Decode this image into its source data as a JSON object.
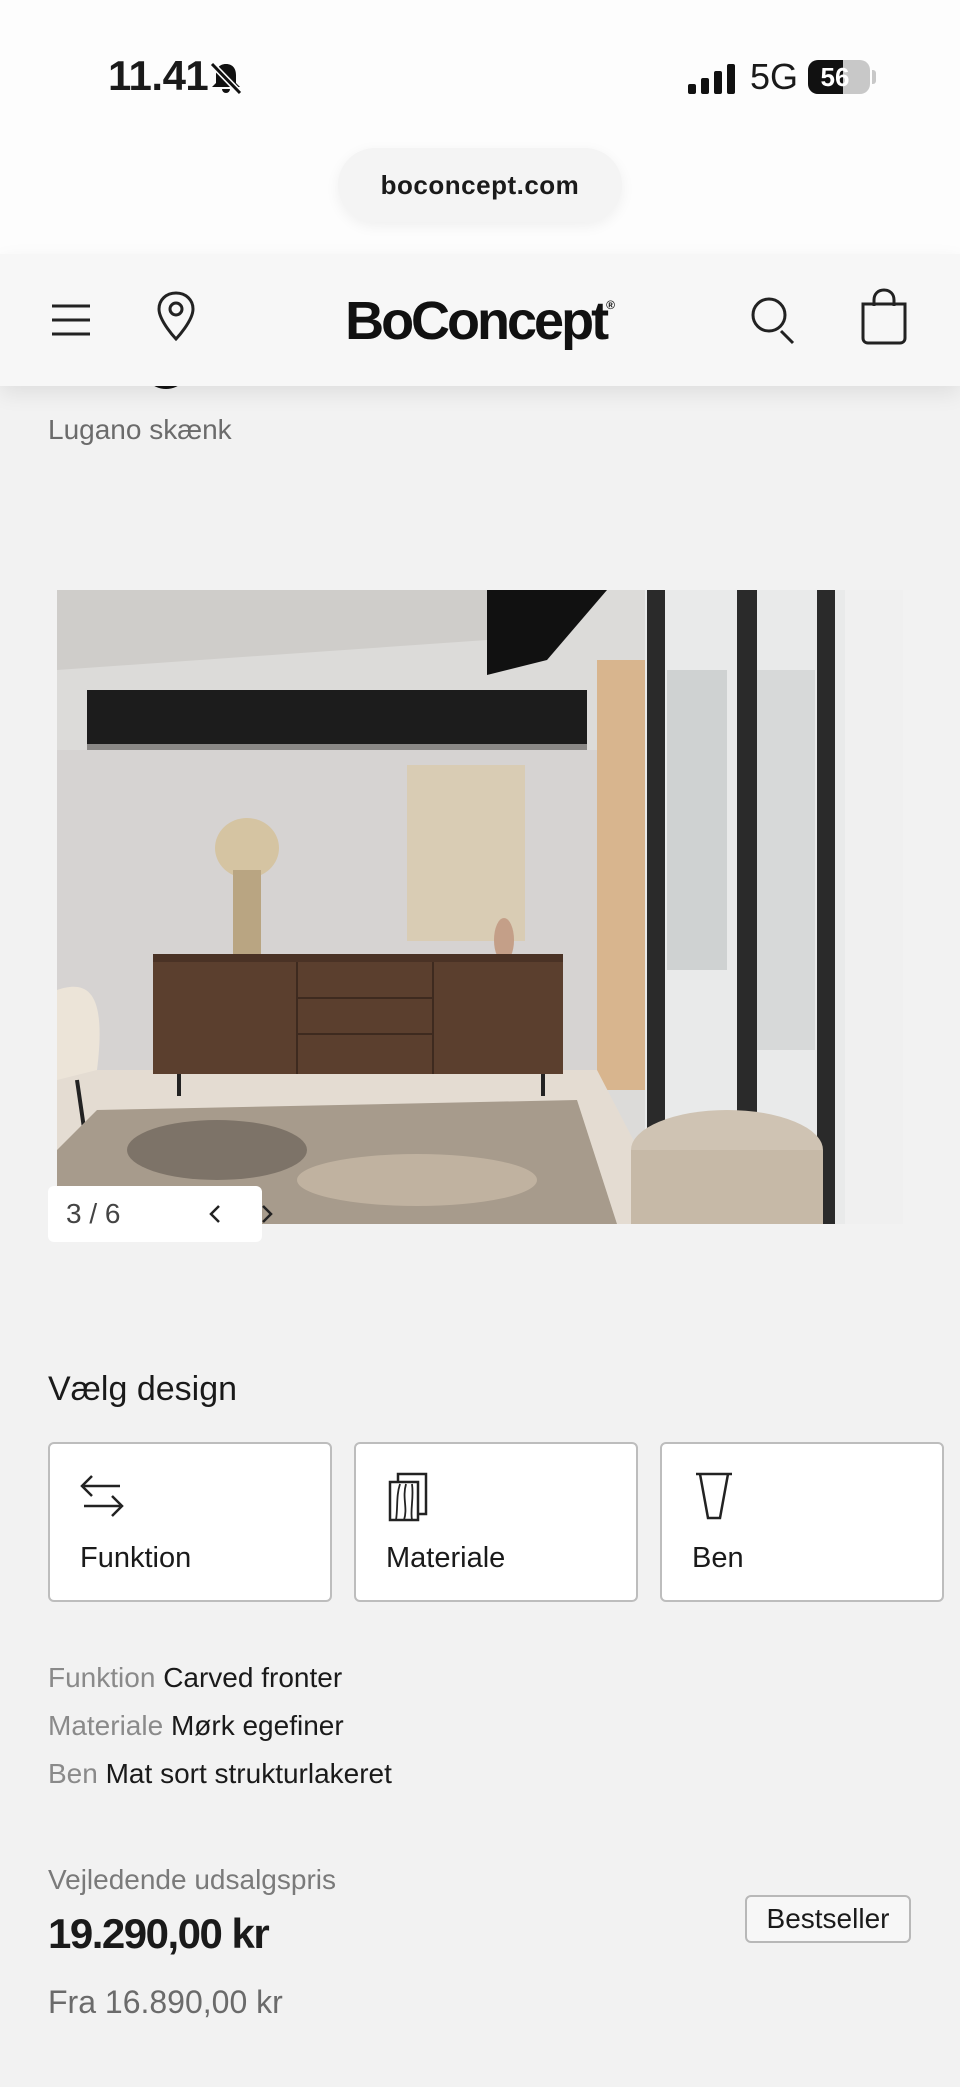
{
  "status_bar": {
    "time": "11.41",
    "network": "5G",
    "battery": "56",
    "battery_level": 0.56
  },
  "browser": {
    "url": "boconcept.com"
  },
  "header": {
    "logo": "BoConcept",
    "logo_mark": "®",
    "icons": [
      "menu-icon",
      "location-pin-icon",
      "search-icon",
      "shopping-bag-icon"
    ]
  },
  "product": {
    "subtitle": "Lugano skænk"
  },
  "gallery": {
    "counter": "3 / 6"
  },
  "design": {
    "heading": "Vælg design",
    "options": [
      {
        "label": "Funktion",
        "icon": "swap-arrows-icon"
      },
      {
        "label": "Materiale",
        "icon": "material-swatch-icon"
      },
      {
        "label": "Ben",
        "icon": "leg-icon"
      }
    ]
  },
  "specs": [
    {
      "key": "Funktion",
      "value": "Carved fronter"
    },
    {
      "key": "Materiale",
      "value": "Mørk egefiner"
    },
    {
      "key": "Ben",
      "value": "Mat sort strukturlakeret"
    }
  ],
  "pricing": {
    "label": "Vejledende udsalgspris",
    "price": "19.290,00 kr",
    "from": "Fra 16.890,00 kr",
    "badge": "Bestseller"
  }
}
